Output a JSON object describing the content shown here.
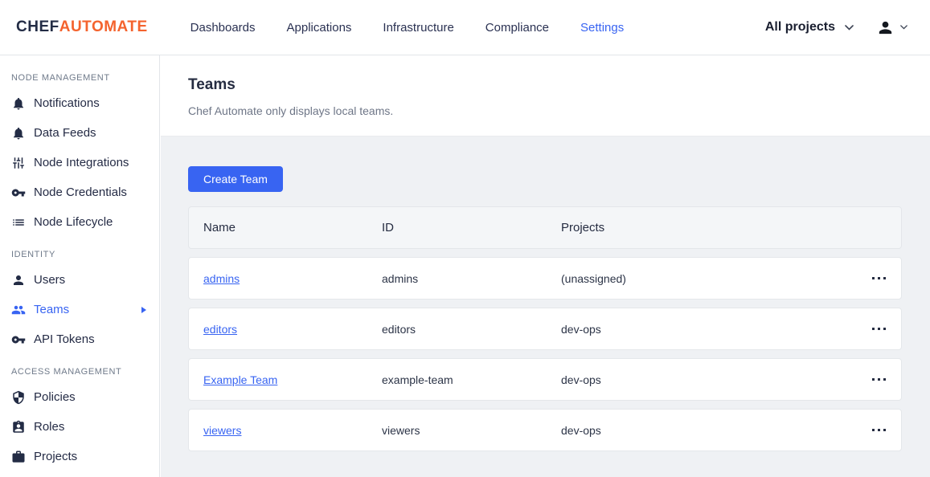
{
  "header": {
    "logo_chef": "CHEF",
    "logo_automate": "AUTOMATE",
    "nav": [
      {
        "label": "Dashboards",
        "active": false
      },
      {
        "label": "Applications",
        "active": false
      },
      {
        "label": "Infrastructure",
        "active": false
      },
      {
        "label": "Compliance",
        "active": false
      },
      {
        "label": "Settings",
        "active": true
      }
    ],
    "projects_dropdown_label": "All projects"
  },
  "sidebar": {
    "sections": [
      {
        "label": "NODE MANAGEMENT",
        "items": [
          {
            "label": "Notifications",
            "icon": "bell-icon",
            "active": false
          },
          {
            "label": "Data Feeds",
            "icon": "bell-icon",
            "active": false
          },
          {
            "label": "Node Integrations",
            "icon": "sliders-icon",
            "active": false
          },
          {
            "label": "Node Credentials",
            "icon": "key-icon",
            "active": false
          },
          {
            "label": "Node Lifecycle",
            "icon": "list-icon",
            "active": false
          }
        ]
      },
      {
        "label": "IDENTITY",
        "items": [
          {
            "label": "Users",
            "icon": "person-icon",
            "active": false
          },
          {
            "label": "Teams",
            "icon": "group-icon",
            "active": true,
            "expandable": true
          },
          {
            "label": "API Tokens",
            "icon": "key-icon",
            "active": false
          }
        ]
      },
      {
        "label": "ACCESS MANAGEMENT",
        "items": [
          {
            "label": "Policies",
            "icon": "shield-icon",
            "active": false
          },
          {
            "label": "Roles",
            "icon": "badge-icon",
            "active": false
          },
          {
            "label": "Projects",
            "icon": "briefcase-icon",
            "active": false
          }
        ]
      }
    ]
  },
  "main": {
    "title": "Teams",
    "subtitle": "Chef Automate only displays local teams.",
    "create_button_label": "Create Team",
    "table": {
      "columns": [
        "Name",
        "ID",
        "Projects"
      ],
      "rows": [
        {
          "name": "admins",
          "id": "admins",
          "projects": "(unassigned)"
        },
        {
          "name": "editors",
          "id": "editors",
          "projects": "dev-ops"
        },
        {
          "name": "Example Team",
          "id": "example-team",
          "projects": "dev-ops"
        },
        {
          "name": "viewers",
          "id": "viewers",
          "projects": "dev-ops"
        }
      ]
    }
  },
  "colors": {
    "accent_blue": "#3864f2",
    "brand_orange": "#f4632e",
    "navy_text": "#252c41",
    "content_background": "#eff1f4"
  }
}
